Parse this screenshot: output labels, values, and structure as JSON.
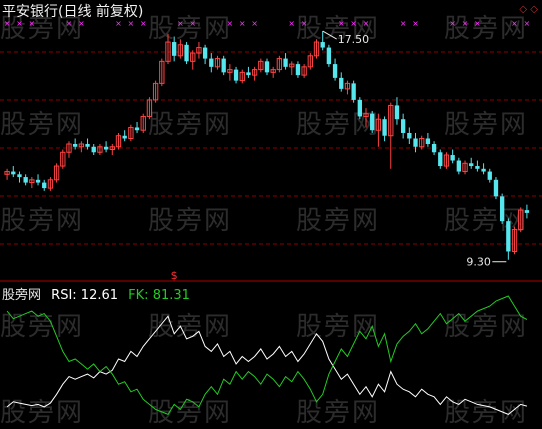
{
  "header": {
    "title": "平安银行(日线 前复权)"
  },
  "watermark": "股旁网",
  "indicator": {
    "site_label": "股旁网",
    "rsi_label": "RSI:",
    "rsi_value": "12.61",
    "fk_label": "FK:",
    "fk_value": "81.31"
  },
  "controls": {
    "zoom_icon": "◇",
    "restore_icon": "◇"
  },
  "colors": {
    "up": "#ff4444",
    "down": "#55e6ee",
    "grid": "#8a0000",
    "rsi": "#ffffff",
    "fk": "#22cc22",
    "marker": "#ff33ff"
  },
  "chart_data": {
    "type": "candlestick",
    "annotations": [
      {
        "text": "17.50",
        "kind": "high"
      },
      {
        "text": "9.30",
        "kind": "low"
      }
    ],
    "signal_marker": "$",
    "price_range": [
      9.0,
      18.0
    ],
    "candles": [
      [
        12.4,
        12.6,
        12.2,
        12.5
      ],
      [
        12.5,
        12.7,
        12.3,
        12.4
      ],
      [
        12.4,
        12.5,
        12.1,
        12.3
      ],
      [
        12.3,
        12.4,
        12.0,
        12.1
      ],
      [
        12.1,
        12.3,
        11.9,
        12.2
      ],
      [
        12.2,
        12.4,
        12.0,
        12.1
      ],
      [
        12.1,
        12.2,
        11.8,
        11.9
      ],
      [
        11.9,
        12.3,
        11.8,
        12.2
      ],
      [
        12.2,
        12.8,
        12.1,
        12.7
      ],
      [
        12.7,
        13.3,
        12.6,
        13.2
      ],
      [
        13.2,
        13.6,
        13.0,
        13.5
      ],
      [
        13.5,
        13.7,
        13.3,
        13.4
      ],
      [
        13.4,
        13.6,
        13.2,
        13.5
      ],
      [
        13.5,
        13.7,
        13.3,
        13.4
      ],
      [
        13.4,
        13.5,
        13.1,
        13.2
      ],
      [
        13.2,
        13.5,
        13.1,
        13.4
      ],
      [
        13.4,
        13.6,
        13.2,
        13.3
      ],
      [
        13.3,
        13.5,
        13.1,
        13.4
      ],
      [
        13.4,
        13.9,
        13.3,
        13.8
      ],
      [
        13.8,
        14.0,
        13.6,
        13.7
      ],
      [
        13.7,
        14.2,
        13.6,
        14.1
      ],
      [
        14.1,
        14.3,
        13.9,
        14.0
      ],
      [
        14.0,
        14.6,
        13.9,
        14.5
      ],
      [
        14.5,
        15.2,
        14.4,
        15.1
      ],
      [
        15.1,
        15.8,
        15.0,
        15.7
      ],
      [
        15.7,
        16.6,
        15.6,
        16.5
      ],
      [
        16.5,
        17.5,
        16.4,
        17.2
      ],
      [
        17.2,
        17.4,
        16.5,
        16.7
      ],
      [
        16.7,
        17.3,
        16.6,
        17.1
      ],
      [
        17.1,
        17.2,
        16.4,
        16.5
      ],
      [
        16.5,
        16.9,
        16.2,
        16.8
      ],
      [
        16.8,
        17.2,
        16.6,
        17.0
      ],
      [
        17.0,
        17.1,
        16.4,
        16.6
      ],
      [
        16.6,
        16.8,
        16.1,
        16.3
      ],
      [
        16.3,
        16.7,
        16.2,
        16.6
      ],
      [
        16.6,
        16.7,
        16.0,
        16.1
      ],
      [
        16.1,
        16.4,
        15.8,
        16.2
      ],
      [
        16.2,
        16.3,
        15.7,
        15.8
      ],
      [
        15.8,
        16.2,
        15.7,
        16.1
      ],
      [
        16.1,
        16.3,
        15.9,
        16.0
      ],
      [
        16.0,
        16.3,
        15.8,
        16.2
      ],
      [
        16.2,
        16.6,
        16.1,
        16.5
      ],
      [
        16.5,
        16.6,
        16.0,
        16.1
      ],
      [
        16.1,
        16.3,
        15.9,
        16.2
      ],
      [
        16.2,
        16.7,
        16.1,
        16.6
      ],
      [
        16.6,
        16.8,
        16.2,
        16.3
      ],
      [
        16.3,
        16.5,
        16.0,
        16.4
      ],
      [
        16.4,
        16.5,
        15.9,
        16.0
      ],
      [
        16.0,
        16.4,
        15.9,
        16.3
      ],
      [
        16.3,
        16.8,
        16.2,
        16.7
      ],
      [
        16.7,
        17.3,
        16.6,
        17.2
      ],
      [
        17.2,
        17.6,
        16.9,
        17.0
      ],
      [
        17.0,
        17.1,
        16.3,
        16.4
      ],
      [
        16.4,
        16.6,
        15.8,
        15.9
      ],
      [
        15.9,
        16.1,
        15.4,
        15.5
      ],
      [
        15.5,
        15.8,
        15.3,
        15.7
      ],
      [
        15.7,
        15.8,
        15.0,
        15.1
      ],
      [
        15.1,
        15.2,
        14.4,
        14.5
      ],
      [
        14.5,
        14.8,
        14.1,
        14.6
      ],
      [
        14.6,
        14.7,
        13.9,
        14.0
      ],
      [
        14.0,
        14.6,
        13.4,
        14.4
      ],
      [
        14.4,
        14.5,
        13.6,
        13.8
      ],
      [
        13.8,
        15.0,
        12.6,
        14.9
      ],
      [
        14.9,
        15.2,
        14.2,
        14.4
      ],
      [
        14.4,
        14.6,
        13.7,
        13.9
      ],
      [
        13.9,
        14.1,
        13.5,
        13.7
      ],
      [
        13.7,
        13.9,
        13.2,
        13.4
      ],
      [
        13.4,
        13.8,
        13.3,
        13.7
      ],
      [
        13.7,
        13.9,
        13.4,
        13.5
      ],
      [
        13.5,
        13.6,
        13.1,
        13.2
      ],
      [
        13.2,
        13.3,
        12.6,
        12.7
      ],
      [
        12.7,
        13.2,
        12.6,
        13.1
      ],
      [
        13.1,
        13.3,
        12.8,
        12.9
      ],
      [
        12.9,
        13.0,
        12.4,
        12.5
      ],
      [
        12.5,
        12.9,
        12.4,
        12.8
      ],
      [
        12.8,
        13.0,
        12.6,
        12.7
      ],
      [
        12.7,
        12.9,
        12.5,
        12.6
      ],
      [
        12.6,
        12.8,
        12.4,
        12.5
      ],
      [
        12.5,
        12.6,
        12.1,
        12.2
      ],
      [
        12.2,
        12.3,
        11.5,
        11.6
      ],
      [
        11.6,
        11.7,
        10.6,
        10.7
      ],
      [
        10.7,
        10.8,
        9.3,
        9.6
      ],
      [
        9.6,
        10.5,
        9.5,
        10.4
      ],
      [
        10.4,
        11.2,
        10.3,
        11.1
      ],
      [
        11.1,
        11.3,
        10.8,
        11.0
      ]
    ],
    "indicator_series": [
      {
        "name": "RSI",
        "values": [
          12,
          16,
          15,
          14,
          13,
          14,
          12,
          15,
          22,
          30,
          36,
          34,
          36,
          38,
          35,
          40,
          38,
          41,
          50,
          48,
          56,
          52,
          60,
          66,
          72,
          78,
          84,
          70,
          76,
          66,
          68,
          72,
          60,
          56,
          62,
          52,
          56,
          46,
          52,
          48,
          52,
          58,
          50,
          54,
          60,
          52,
          56,
          48,
          54,
          62,
          70,
          64,
          50,
          42,
          34,
          38,
          30,
          22,
          28,
          20,
          30,
          24,
          40,
          30,
          26,
          24,
          20,
          26,
          22,
          20,
          14,
          20,
          16,
          14,
          18,
          16,
          14,
          13,
          12,
          10,
          8,
          6,
          10,
          14,
          12.61
        ]
      },
      {
        "name": "FK",
        "values": [
          88,
          82,
          84,
          86,
          88,
          84,
          86,
          80,
          68,
          56,
          48,
          50,
          46,
          42,
          46,
          40,
          44,
          38,
          30,
          32,
          24,
          26,
          18,
          14,
          10,
          8,
          6,
          14,
          10,
          18,
          16,
          12,
          22,
          28,
          22,
          34,
          30,
          40,
          34,
          40,
          36,
          30,
          38,
          34,
          28,
          36,
          32,
          40,
          34,
          26,
          16,
          22,
          38,
          48,
          58,
          52,
          62,
          72,
          66,
          76,
          60,
          70,
          48,
          62,
          68,
          72,
          78,
          70,
          74,
          80,
          86,
          78,
          82,
          86,
          80,
          84,
          88,
          90,
          92,
          96,
          98,
          100,
          92,
          84,
          81.31
        ]
      }
    ]
  }
}
